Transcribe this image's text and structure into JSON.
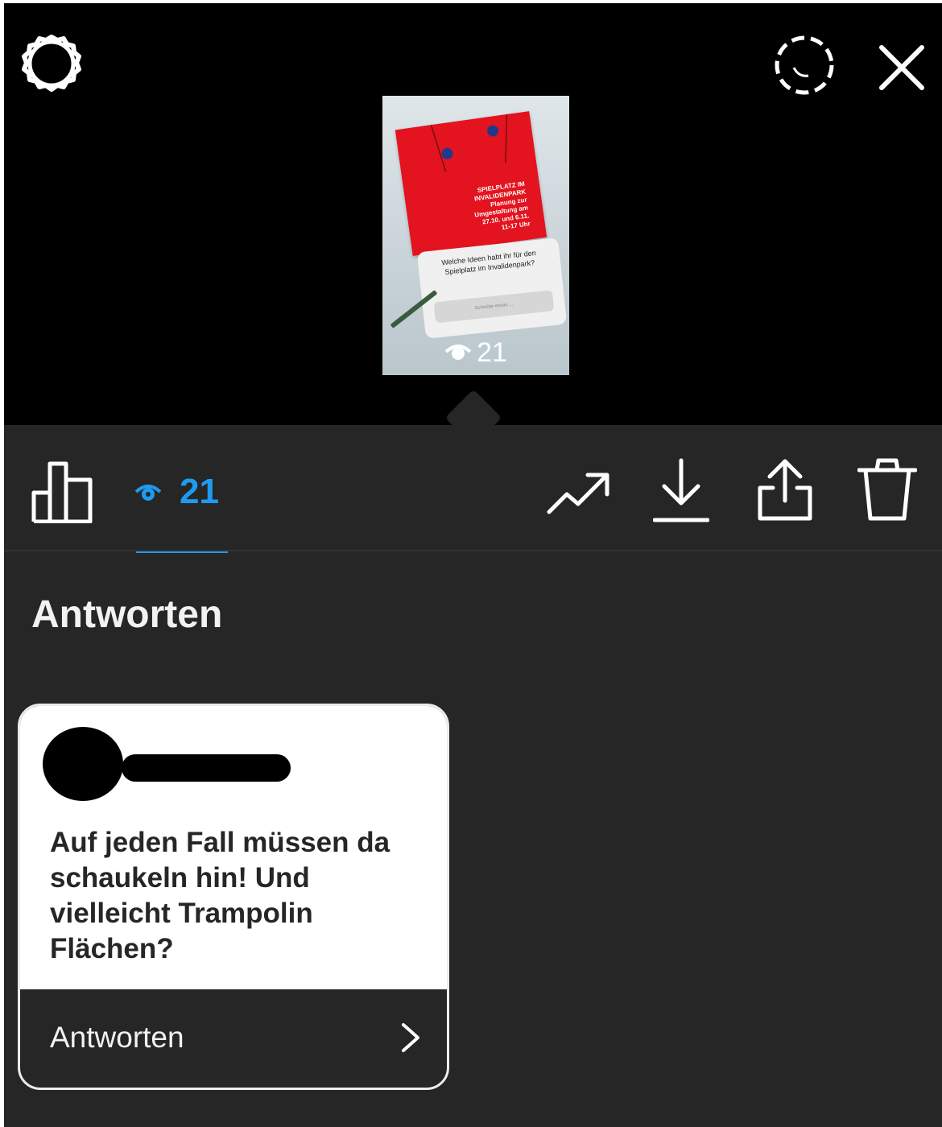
{
  "preview": {
    "poster_lines": [
      "SPIELPLATZ IM",
      "INVALIDENPARK",
      "Planung zur",
      "Umgestaltung am",
      "27.10. und 6.11.",
      "11-17 Uhr"
    ],
    "question": "Welche Ideen habt ihr für den Spielplatz im Invalidenpark?",
    "input_placeholder": "Schreibe etwas ...",
    "views": "21"
  },
  "toolbar": {
    "views_count": "21",
    "icons": [
      "stats-icon",
      "eye-icon",
      "trend-icon",
      "download-icon",
      "share-icon",
      "trash-icon"
    ],
    "active_color": "#1e9bf0"
  },
  "section": {
    "title": "Antworten"
  },
  "reply": {
    "text": "Auf jeden Fall müssen da schaukeln hin! Und vielleicht Trampolin Flächen?",
    "action_label": "Antworten"
  }
}
